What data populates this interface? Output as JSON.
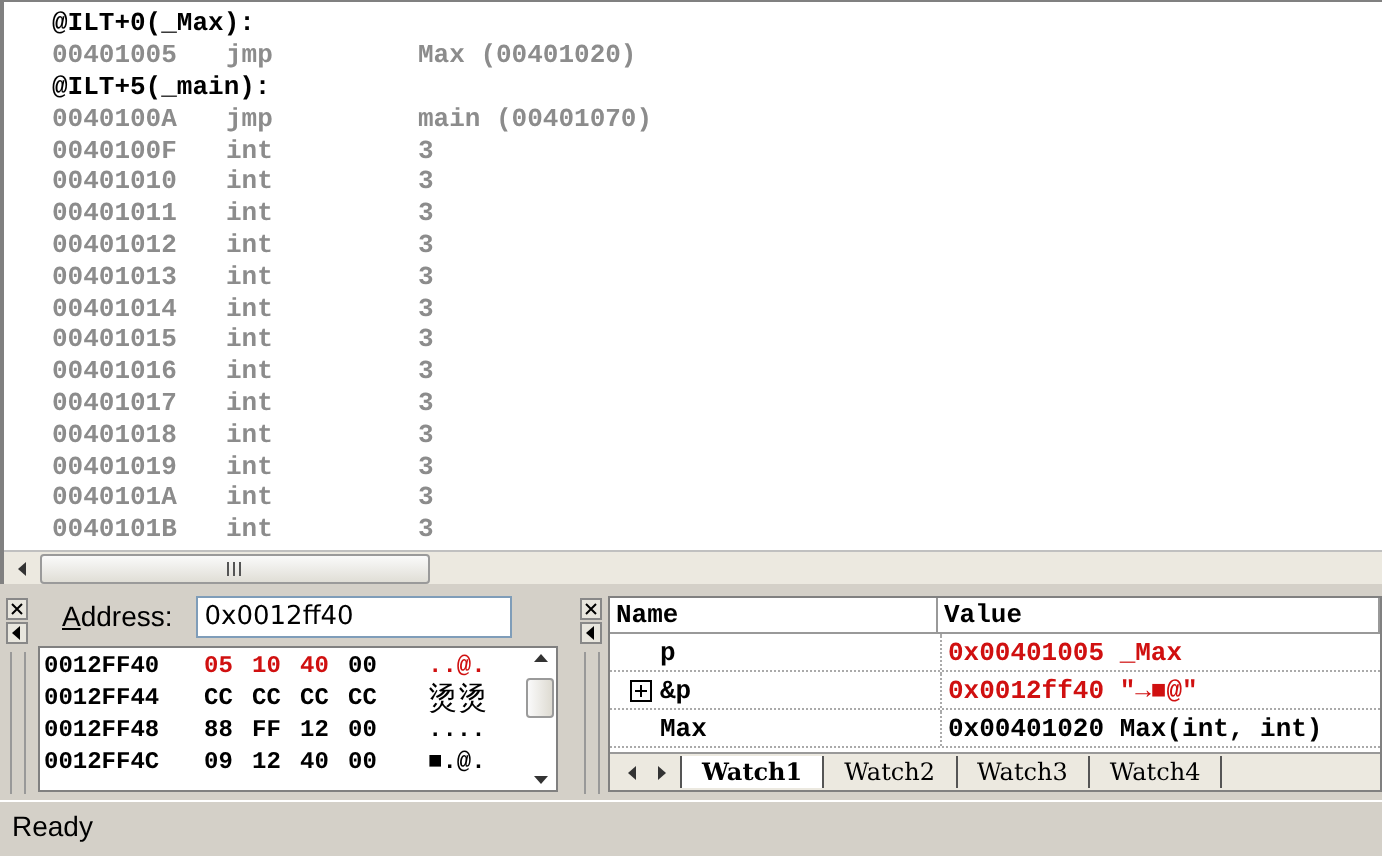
{
  "disassembly": {
    "lines": [
      {
        "kind": "label",
        "text": "@ILT+0(_Max):"
      },
      {
        "kind": "instr",
        "address": "00401005",
        "mnemonic": "jmp",
        "operand": "Max (00401020)"
      },
      {
        "kind": "label",
        "text": "@ILT+5(_main):"
      },
      {
        "kind": "instr",
        "address": "0040100A",
        "mnemonic": "jmp",
        "operand": "main (00401070)"
      },
      {
        "kind": "instr",
        "address": "0040100F",
        "mnemonic": "int",
        "operand": "3"
      },
      {
        "kind": "instr",
        "address": "00401010",
        "mnemonic": "int",
        "operand": "3"
      },
      {
        "kind": "instr",
        "address": "00401011",
        "mnemonic": "int",
        "operand": "3"
      },
      {
        "kind": "instr",
        "address": "00401012",
        "mnemonic": "int",
        "operand": "3"
      },
      {
        "kind": "instr",
        "address": "00401013",
        "mnemonic": "int",
        "operand": "3"
      },
      {
        "kind": "instr",
        "address": "00401014",
        "mnemonic": "int",
        "operand": "3"
      },
      {
        "kind": "instr",
        "address": "00401015",
        "mnemonic": "int",
        "operand": "3"
      },
      {
        "kind": "instr",
        "address": "00401016",
        "mnemonic": "int",
        "operand": "3"
      },
      {
        "kind": "instr",
        "address": "00401017",
        "mnemonic": "int",
        "operand": "3"
      },
      {
        "kind": "instr",
        "address": "00401018",
        "mnemonic": "int",
        "operand": "3"
      },
      {
        "kind": "instr",
        "address": "00401019",
        "mnemonic": "int",
        "operand": "3"
      },
      {
        "kind": "instr",
        "address": "0040101A",
        "mnemonic": "int",
        "operand": "3"
      },
      {
        "kind": "instr",
        "address": "0040101B",
        "mnemonic": "int",
        "operand": "3"
      }
    ]
  },
  "memory": {
    "address_label": "Address:",
    "address_value": "0x0012ff40",
    "rows": [
      {
        "address": "0012FF40",
        "bytes": [
          {
            "value": "05",
            "changed": true
          },
          {
            "value": "10",
            "changed": true
          },
          {
            "value": "40",
            "changed": true
          },
          {
            "value": "00",
            "changed": false
          }
        ],
        "ascii": "..@.",
        "ascii_changed": true
      },
      {
        "address": "0012FF44",
        "bytes": [
          {
            "value": "CC",
            "changed": false
          },
          {
            "value": "CC",
            "changed": false
          },
          {
            "value": "CC",
            "changed": false
          },
          {
            "value": "CC",
            "changed": false
          }
        ],
        "ascii": "烫烫",
        "ascii_changed": false
      },
      {
        "address": "0012FF48",
        "bytes": [
          {
            "value": "88",
            "changed": false
          },
          {
            "value": "FF",
            "changed": false
          },
          {
            "value": "12",
            "changed": false
          },
          {
            "value": "00",
            "changed": false
          }
        ],
        "ascii": "....",
        "ascii_changed": false
      },
      {
        "address": "0012FF4C",
        "bytes": [
          {
            "value": "09",
            "changed": false
          },
          {
            "value": "12",
            "changed": false
          },
          {
            "value": "40",
            "changed": false
          },
          {
            "value": "00",
            "changed": false
          }
        ],
        "ascii": "■.@.",
        "ascii_changed": false
      }
    ]
  },
  "watch": {
    "columns": [
      "Name",
      "Value"
    ],
    "rows": [
      {
        "name": "p",
        "value": "0x00401005 _Max",
        "changed": true,
        "expandable": false
      },
      {
        "name": "&p",
        "value": "0x0012ff40 \"→■@\"",
        "changed": true,
        "expandable": true
      },
      {
        "name": "Max",
        "value": "0x00401020 Max(int, int)",
        "changed": false,
        "expandable": false
      }
    ],
    "tabs": [
      {
        "label": "Watch1",
        "selected": true
      },
      {
        "label": "Watch2",
        "selected": false
      },
      {
        "label": "Watch3",
        "selected": false
      },
      {
        "label": "Watch4",
        "selected": false
      }
    ]
  },
  "status_bar": {
    "text": "Ready"
  }
}
